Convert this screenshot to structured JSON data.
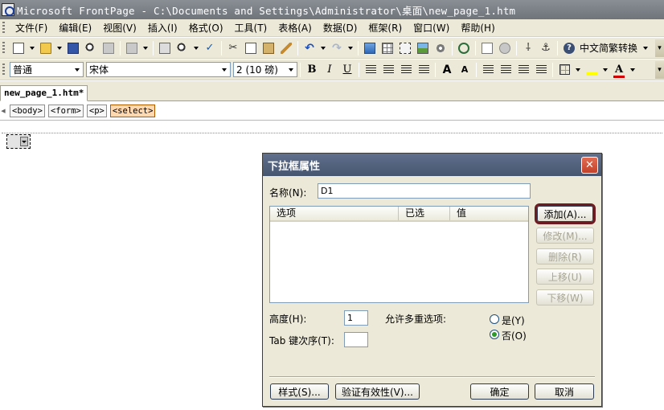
{
  "window": {
    "title": "Microsoft FrontPage - C:\\Documents and Settings\\Administrator\\桌面\\new_page_1.htm"
  },
  "menu": {
    "items": [
      "文件(F)",
      "编辑(E)",
      "视图(V)",
      "插入(I)",
      "格式(O)",
      "工具(T)",
      "表格(A)",
      "数据(D)",
      "框架(R)",
      "窗口(W)",
      "帮助(H)"
    ]
  },
  "toolbar": {
    "convert_label": "中文简繁转换"
  },
  "format_toolbar": {
    "style_value": "普通",
    "font_value": "宋体",
    "size_value": "2 (10 磅)",
    "bold": "B",
    "italic": "I",
    "underline": "U",
    "grow_font": "A",
    "shrink_font": "A",
    "font_color": "A"
  },
  "document": {
    "tab_label": "new_page_1.htm*",
    "tags": [
      "<body>",
      "<form>",
      "<p>",
      "<select>"
    ]
  },
  "dialog": {
    "title": "下拉框属性",
    "close_glyph": "✕",
    "name_label": "名称(N):",
    "name_value": "D1",
    "columns": [
      "选项",
      "已选",
      "值"
    ],
    "buttons": {
      "add": "添加(A)...",
      "modify": "修改(M)...",
      "remove": "删除(R)",
      "move_up": "上移(U)",
      "move_down": "下移(W)",
      "style": "样式(S)...",
      "validate": "验证有效性(V)...",
      "ok": "确定",
      "cancel": "取消"
    },
    "height_label": "高度(H):",
    "height_value": "1",
    "tab_order_label": "Tab 键次序(T):",
    "tab_order_value": "",
    "multi_label": "允许多重选项:",
    "yes_label": "是(Y)",
    "no_label": "否(O)",
    "multi_selected": "否(O)"
  },
  "colors": {
    "titlebar": "#8a8f96",
    "chrome": "#ece9d8",
    "dialog_title": "#5f6f8d",
    "highlight_outline": "#6d1d22",
    "active_tag": "#ffd8b0"
  }
}
